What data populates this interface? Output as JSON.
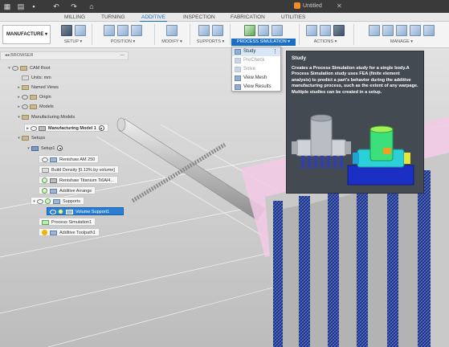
{
  "titlebar": {
    "doc_title": "Untitled",
    "icons": [
      "grid-icon",
      "file-icon",
      "save-icon",
      "undo-icon",
      "redo-icon",
      "home-icon"
    ]
  },
  "ribbon_tabs": [
    {
      "label": "MILLING",
      "active": false
    },
    {
      "label": "TURNING",
      "active": false
    },
    {
      "label": "ADDITIVE",
      "active": true
    },
    {
      "label": "INSPECTION",
      "active": false
    },
    {
      "label": "FABRICATION",
      "active": false
    },
    {
      "label": "UTILITIES",
      "active": false
    }
  ],
  "toolbar": {
    "workspace_label": "MANUFACTURE",
    "groups": {
      "setup": "SETUP",
      "position": "POSITION",
      "modify": "MODIFY",
      "supports": "SUPPORTS",
      "process_simulation": "PROCESS SIMULATION",
      "actions": "ACTIONS",
      "manage": "MANAGE"
    }
  },
  "dropdown": {
    "items": [
      {
        "label": "Study",
        "selected": true,
        "enabled": true
      },
      {
        "label": "PreCheck",
        "selected": false,
        "enabled": false
      },
      {
        "label": "Solve",
        "selected": false,
        "enabled": false
      },
      {
        "label": "View Mesh",
        "selected": false,
        "enabled": true
      },
      {
        "label": "View Results",
        "selected": false,
        "enabled": true
      }
    ]
  },
  "tooltip": {
    "title": "Study",
    "body": "Creates a Process Simulation study for a single body.A Process Simulation study uses FEA (finite element analysis) to predict a part's behavior during the additive manufacturing process, such as the extent of any warpage. Multiple studies can be created in a setup."
  },
  "browser": {
    "header": "BROWSER",
    "rows": [
      {
        "label": "CAM Root"
      },
      {
        "label": "Units: mm"
      },
      {
        "label": "Named Views"
      },
      {
        "label": "Origin"
      },
      {
        "label": "Models"
      },
      {
        "label": "Manufacturing Models"
      },
      {
        "label": "Manufacturing Model 1"
      },
      {
        "label": "Setups"
      },
      {
        "label": "Setup1"
      },
      {
        "label": "Renishaw AM 250"
      },
      {
        "label": "Build Density [0.13% by volume]"
      },
      {
        "label": "Renishaw Titanium Ti6Al4..."
      },
      {
        "label": "Additive Arrange"
      },
      {
        "label": "Supports"
      },
      {
        "label": "Volume Support1"
      },
      {
        "label": "Process Simulation1"
      },
      {
        "label": "Additive Toolpath1"
      }
    ]
  },
  "colors": {
    "accent": "#1a6fc4",
    "tooltip_bg": "#444a52",
    "support_blue": "#1f3a8c",
    "part_pink": "#f3c9e6",
    "selection": "#2a7fd4"
  }
}
